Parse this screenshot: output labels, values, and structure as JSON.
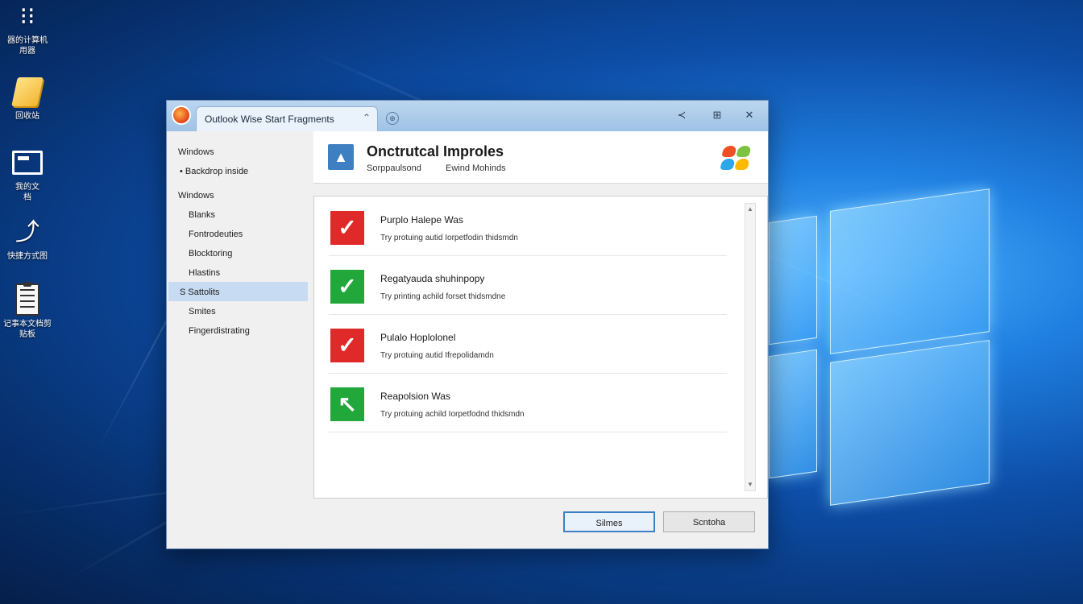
{
  "desktop": {
    "icons": [
      {
        "label_line1": "器的计算机",
        "label_line2": "用器",
        "icon": "computer-icon"
      },
      {
        "label_line1": "回收站",
        "label_line2": "",
        "icon": "notes-icon"
      },
      {
        "label_line1": "我的文",
        "label_line2": "档",
        "icon": "folder-icon"
      },
      {
        "label_line1": "快捷方式图",
        "label_line2": "",
        "icon": "shortcut-icon"
      },
      {
        "label_line1": "记事本文档剪",
        "label_line2": "贴板",
        "icon": "clipboard-icon"
      }
    ]
  },
  "window": {
    "tab_label": "Outlook Wise Start Fragments",
    "tab_close": "⌃",
    "new_tab": "⊕",
    "titlebar_buttons": {
      "back": "≺",
      "grid": "⊞",
      "close": "✕"
    },
    "sidebar": {
      "items": [
        {
          "label": "Windows",
          "level": "top"
        },
        {
          "label": "• Backdrop inside",
          "level": "sub"
        },
        {
          "label": "Windows",
          "level": "top"
        },
        {
          "label": "Blanks",
          "level": "child"
        },
        {
          "label": "Fontrodeuties",
          "level": "child"
        },
        {
          "label": "Blocktoring",
          "level": "child"
        },
        {
          "label": "Hlastins",
          "level": "child"
        },
        {
          "label": "S Sattolits",
          "level": "child",
          "selected": true
        },
        {
          "label": "Smites",
          "level": "child"
        },
        {
          "label": "Fingerdistrating",
          "level": "child"
        }
      ]
    },
    "header": {
      "icon_glyph": "▲",
      "title": "Onctrutcal Improles",
      "subtitle_left": "Sorppaulsond",
      "subtitle_right": "Ewind Mohinds"
    },
    "list": [
      {
        "status": "red",
        "glyph": "✓",
        "title": "Purplo Halepe Was",
        "desc": "Try protuing autid Iorpetfodin thidsmdn"
      },
      {
        "status": "green",
        "glyph": "✓",
        "title": "Regatyauda shuhinpopy",
        "desc": "Try printing achild forset thidsmdne"
      },
      {
        "status": "red",
        "glyph": "✓",
        "title": "Pulalo Hoplolonel",
        "desc": "Try protuing autid Ifrepolidamdn"
      },
      {
        "status": "green",
        "glyph": "↖",
        "title": "Reapolsion Was",
        "desc": "Try protuing achild Iorpetfodnd thidsmdn"
      }
    ],
    "scroll": {
      "up": "▲",
      "down": "▼"
    },
    "footer": {
      "primary_label": "Silmes",
      "secondary_label": "Scntoha"
    }
  },
  "colors": {
    "accent": "#3c7fc4",
    "error": "#e02a2a",
    "success": "#22a83a",
    "selected": "#c7dcf2"
  }
}
